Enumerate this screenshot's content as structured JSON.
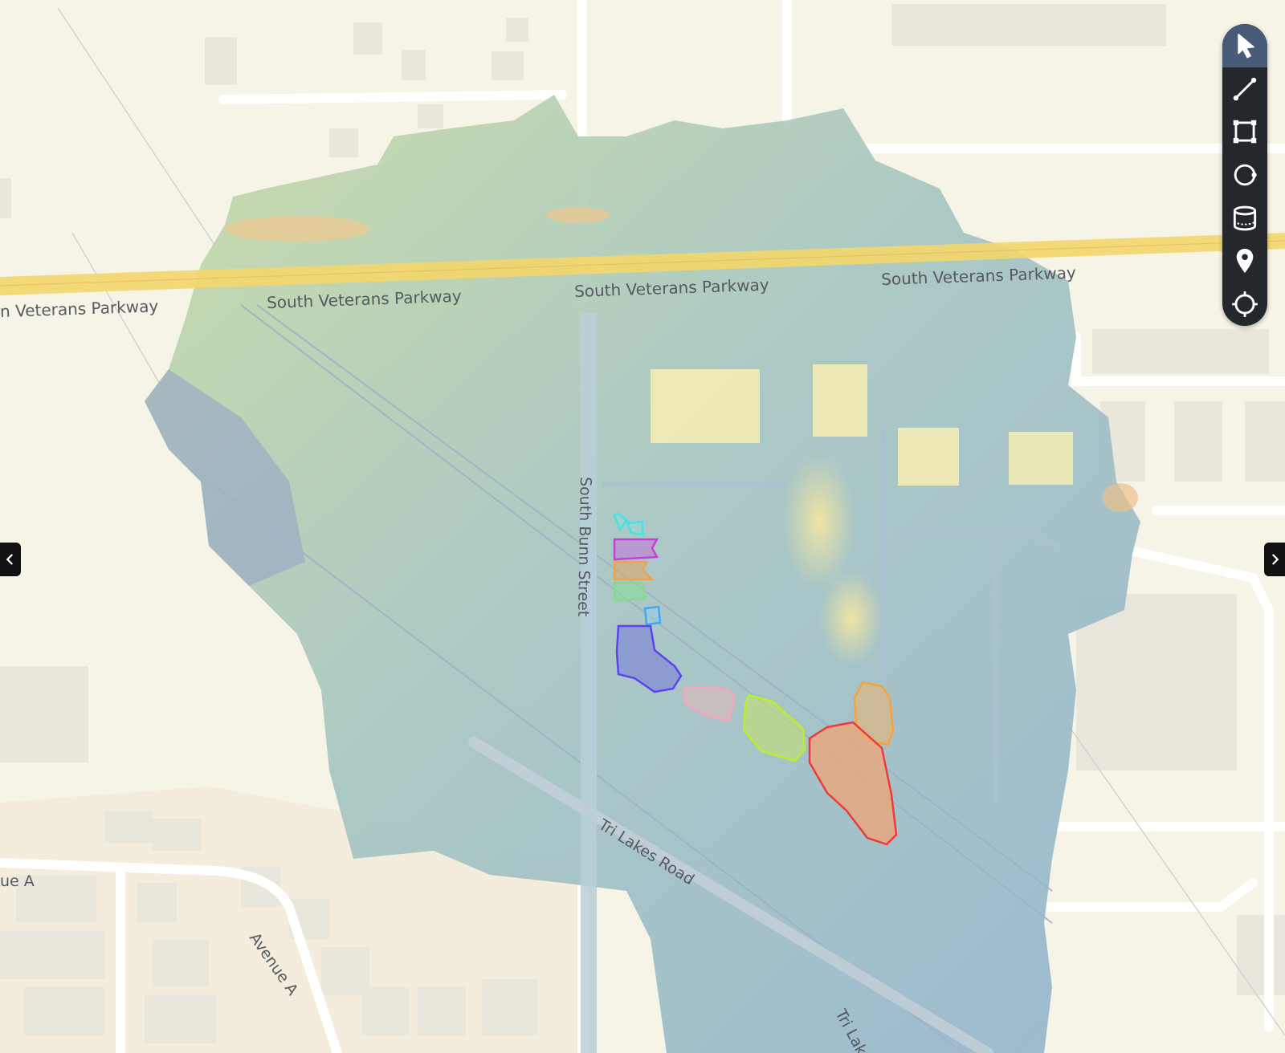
{
  "map": {
    "roads": {
      "parkway_left": "n Veterans Parkway",
      "parkway_1": "South Veterans Parkway",
      "parkway_2": "South Veterans Parkway",
      "parkway_3": "South Veterans Parkway",
      "bunn_street": "South Bunn Street",
      "tri_lakes_1": "Tri Lakes Road",
      "tri_lakes_2": "Tri Lake",
      "avenue_a": "Avenue A",
      "avenue_a_left": "ue A"
    }
  },
  "toolbar": {
    "tools": [
      {
        "name": "select",
        "icon": "cursor-icon"
      },
      {
        "name": "measure-line",
        "icon": "line-icon"
      },
      {
        "name": "measure-area",
        "icon": "polygon-icon"
      },
      {
        "name": "measure-circle",
        "icon": "circle-icon"
      },
      {
        "name": "measure-volume",
        "icon": "volume-icon"
      },
      {
        "name": "marker",
        "icon": "pin-icon"
      },
      {
        "name": "locate",
        "icon": "crosshair-icon"
      }
    ],
    "active": "select"
  },
  "colors": {
    "background": "#f6f3e7",
    "highway": "#f3d66a",
    "toolbar": "#24272b",
    "toolbar_active": "#475a78"
  }
}
